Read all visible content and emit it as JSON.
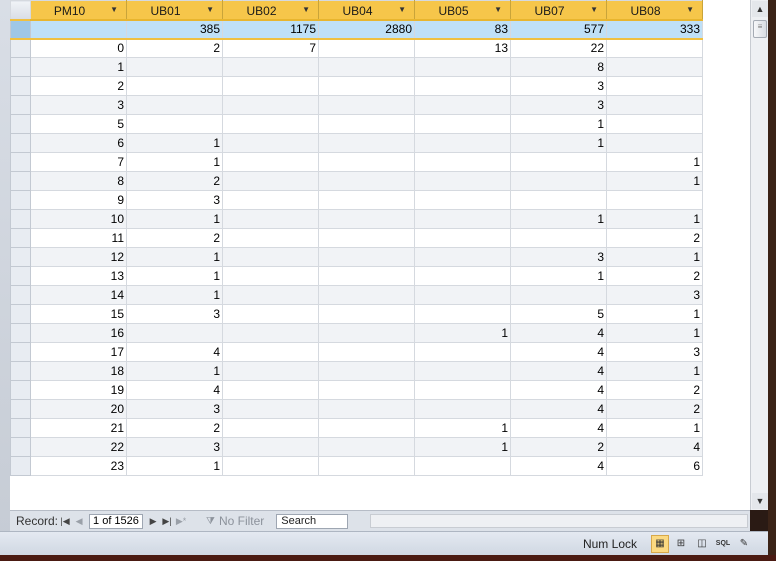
{
  "columns": [
    "PM10",
    "UB01",
    "UB02",
    "UB04",
    "UB05",
    "UB07",
    "UB08"
  ],
  "totals": [
    "",
    "385",
    "1175",
    "2880",
    "83",
    "577",
    "333"
  ],
  "rows": [
    [
      "0",
      "2",
      "7",
      "",
      "13",
      "22",
      ""
    ],
    [
      "1",
      "",
      "",
      "",
      "",
      "8",
      ""
    ],
    [
      "2",
      "",
      "",
      "",
      "",
      "3",
      ""
    ],
    [
      "3",
      "",
      "",
      "",
      "",
      "3",
      ""
    ],
    [
      "5",
      "",
      "",
      "",
      "",
      "1",
      ""
    ],
    [
      "6",
      "1",
      "",
      "",
      "",
      "1",
      ""
    ],
    [
      "7",
      "1",
      "",
      "",
      "",
      "",
      "1"
    ],
    [
      "8",
      "2",
      "",
      "",
      "",
      "",
      "1"
    ],
    [
      "9",
      "3",
      "",
      "",
      "",
      "",
      ""
    ],
    [
      "10",
      "1",
      "",
      "",
      "",
      "1",
      "1"
    ],
    [
      "11",
      "2",
      "",
      "",
      "",
      "",
      "2"
    ],
    [
      "12",
      "1",
      "",
      "",
      "",
      "3",
      "1"
    ],
    [
      "13",
      "1",
      "",
      "",
      "",
      "1",
      "2"
    ],
    [
      "14",
      "1",
      "",
      "",
      "",
      "",
      "3"
    ],
    [
      "15",
      "3",
      "",
      "",
      "",
      "5",
      "1"
    ],
    [
      "16",
      "",
      "",
      "",
      "1",
      "4",
      "1"
    ],
    [
      "17",
      "4",
      "",
      "",
      "",
      "4",
      "3"
    ],
    [
      "18",
      "1",
      "",
      "",
      "",
      "4",
      "1"
    ],
    [
      "19",
      "4",
      "",
      "",
      "",
      "4",
      "2"
    ],
    [
      "20",
      "3",
      "",
      "",
      "",
      "4",
      "2"
    ],
    [
      "21",
      "2",
      "",
      "",
      "1",
      "4",
      "1"
    ],
    [
      "22",
      "3",
      "",
      "",
      "1",
      "2",
      "4"
    ],
    [
      "23",
      "1",
      "",
      "",
      "",
      "4",
      "6"
    ]
  ],
  "navigation": {
    "record_label": "Record:",
    "position": "1 of 1526",
    "filter_label": "No Filter",
    "search_label": "Search"
  },
  "status": {
    "num_lock": "Num Lock",
    "view_sql": "SQL"
  },
  "colors": {
    "header_bg": "#f6c64a",
    "selected_row_bg": "#bfe0f7",
    "alt_row_bg": "#f1f3f6"
  }
}
